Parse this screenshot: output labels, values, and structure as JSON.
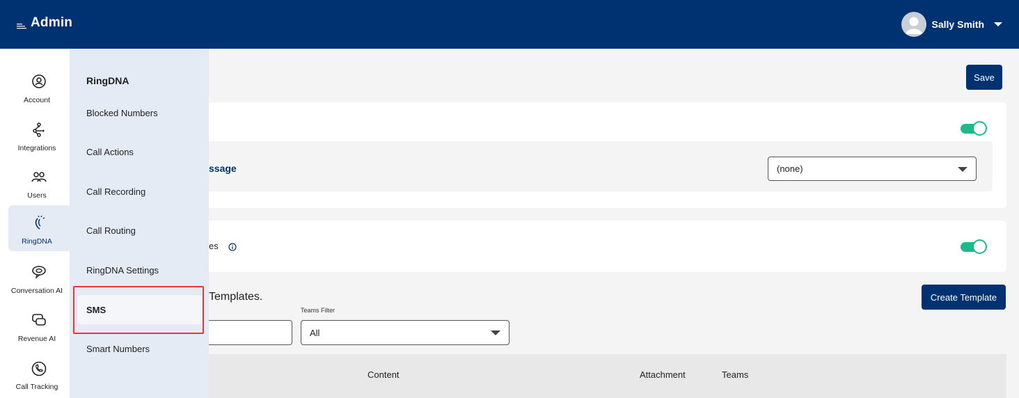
{
  "header": {
    "app_title": "Admin",
    "user_name": "Sally Smith"
  },
  "rail": {
    "items": [
      {
        "label": "Account",
        "icon": "account-icon"
      },
      {
        "label": "Integrations",
        "icon": "integrations-icon"
      },
      {
        "label": "Users",
        "icon": "users-icon"
      },
      {
        "label": "RingDNA",
        "icon": "ringdna-icon",
        "active": true
      },
      {
        "label": "Conversation AI",
        "icon": "conversation-ai-icon"
      },
      {
        "label": "Revenue AI",
        "icon": "revenue-ai-icon"
      },
      {
        "label": "Call Tracking",
        "icon": "call-tracking-icon"
      }
    ]
  },
  "flyout": {
    "title": "RingDNA",
    "items": [
      {
        "label": "Blocked Numbers"
      },
      {
        "label": "Call Actions"
      },
      {
        "label": "Call Recording"
      },
      {
        "label": "Call Routing"
      },
      {
        "label": "RingDNA Settings"
      },
      {
        "label": "SMS",
        "active": true
      },
      {
        "label": "Smart Numbers"
      }
    ]
  },
  "main": {
    "save_label": "Save",
    "card1": {
      "label_partial": "ssage",
      "toggle_on": true,
      "select_value": "(none)"
    },
    "card2": {
      "label_partial": "es",
      "toggle_on": true
    },
    "templates": {
      "title_partial": "Templates.",
      "create_label": "Create Template",
      "teams_filter_label": "Teams Filter",
      "teams_filter_value": "All",
      "columns": [
        "Content",
        "Attachment",
        "Teams"
      ]
    }
  },
  "colors": {
    "header_bg": "#003170",
    "accent": "#003170",
    "toggle_on": "#1db98a",
    "highlight": "#e53935",
    "flyout_bg": "#e4ebf4"
  }
}
